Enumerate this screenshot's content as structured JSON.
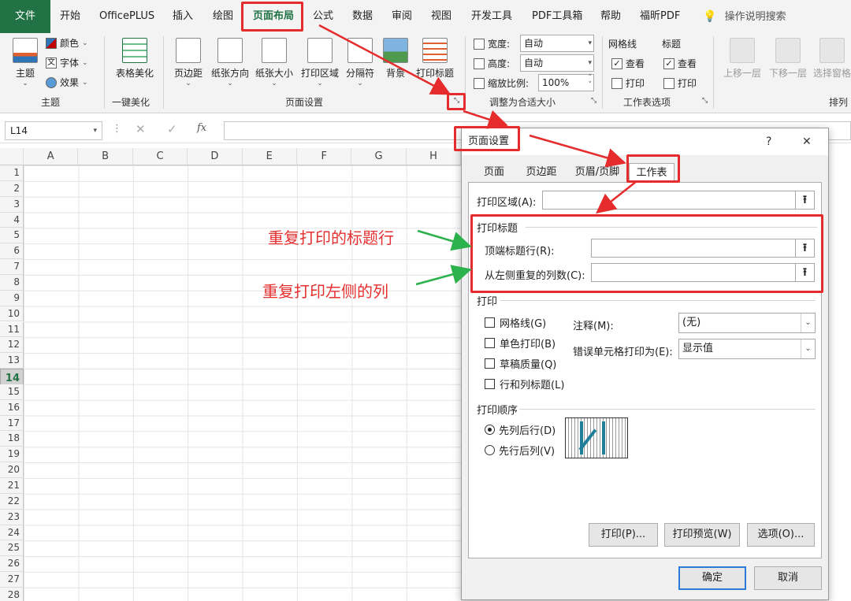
{
  "tabs": [
    "文件",
    "开始",
    "OfficePLUS",
    "插入",
    "绘图",
    "页面布局",
    "公式",
    "数据",
    "审阅",
    "视图",
    "开发工具",
    "PDF工具箱",
    "帮助",
    "福昕PDF"
  ],
  "search": {
    "label": "操作说明搜索"
  },
  "ribbon": {
    "theme": {
      "btn": "主题",
      "colors": "颜色",
      "fonts": "字体",
      "effects": "效果",
      "group": "主题"
    },
    "beautify": {
      "btn": "表格美化",
      "group": "一键美化"
    },
    "page_setup": {
      "margins": "页边距",
      "orientation": "纸张方向",
      "size": "纸张大小",
      "print_area": "打印区域",
      "breaks": "分隔符",
      "background": "背景",
      "print_titles": "打印标题",
      "group": "页面设置"
    },
    "scale": {
      "width_label": "宽度:",
      "width_value": "自动",
      "height_label": "高度:",
      "height_value": "自动",
      "zoom_label": "缩放比例:",
      "zoom_value": "100%",
      "group": "调整为合适大小"
    },
    "sheet_options": {
      "gridlines": "网格线",
      "headings": "标题",
      "view": "查看",
      "view2": "查看",
      "print": "打印",
      "print2": "打印",
      "group": "工作表选项"
    },
    "arrange": {
      "forward": "上移一层",
      "backward": "下移一层",
      "selection": "选择窗格",
      "group": "排列"
    }
  },
  "namebox": "L14",
  "fx": "fx",
  "columns": [
    "A",
    "B",
    "C",
    "D",
    "E",
    "F",
    "G",
    "H"
  ],
  "rows": [
    "1",
    "2",
    "3",
    "4",
    "5",
    "6",
    "7",
    "8",
    "9",
    "10",
    "11",
    "12",
    "13",
    "14",
    "15",
    "16",
    "17",
    "18",
    "19",
    "20",
    "21",
    "22",
    "23",
    "24",
    "25",
    "26",
    "27",
    "28"
  ],
  "dialog": {
    "title": "页面设置",
    "help": "?",
    "close": "✕",
    "tabs": [
      "页面",
      "页边距",
      "页眉/页脚",
      "工作表"
    ],
    "print_area": "打印区域(A):",
    "print_titles_section": "打印标题",
    "rows_to_repeat": "顶端标题行(R):",
    "cols_to_repeat": "从左侧重复的列数(C):",
    "print_section": "打印",
    "gridlines": "网格线(G)",
    "mono": "单色打印(B)",
    "draft": "草稿质量(Q)",
    "headings": "行和列标题(L)",
    "comments_label": "注释(M):",
    "comments_value": "(无)",
    "errors_label": "错误单元格打印为(E):",
    "errors_value": "显示值",
    "order_section": "打印顺序",
    "down_then_over": "先列后行(D)",
    "over_then_down": "先行后列(V)",
    "print_btn": "打印(P)...",
    "preview_btn": "打印预览(W)",
    "options_btn": "选项(O)...",
    "ok": "确定",
    "cancel": "取消"
  },
  "annotations": {
    "repeat_rows": "重复打印的标题行",
    "repeat_cols": "重复打印左侧的列"
  },
  "colors": {
    "excel_green": "#217346",
    "highlight_red": "#e52b2b",
    "arrow_green": "#2bb24c"
  }
}
